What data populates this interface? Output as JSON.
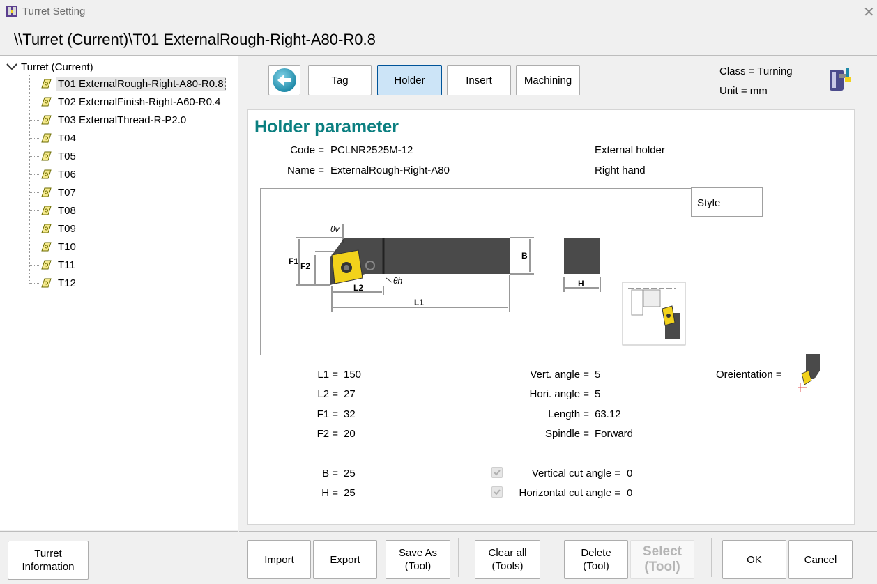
{
  "window": {
    "title": "Turret Setting",
    "path": "\\\\Turret (Current)\\T01 ExternalRough-Right-A80-R0.8"
  },
  "tree": {
    "root": "Turret (Current)",
    "items": [
      {
        "label": "T01 ExternalRough-Right-A80-R0.8",
        "selected": true
      },
      {
        "label": "T02 ExternalFinish-Right-A60-R0.4"
      },
      {
        "label": "T03 ExternalThread-R-P2.0"
      },
      {
        "label": "T04"
      },
      {
        "label": "T05"
      },
      {
        "label": "T06"
      },
      {
        "label": "T07"
      },
      {
        "label": "T08"
      },
      {
        "label": "T09"
      },
      {
        "label": "T10"
      },
      {
        "label": "T11"
      },
      {
        "label": "T12"
      }
    ]
  },
  "tabs": {
    "tag": "Tag",
    "holder": "Holder",
    "insert": "Insert",
    "machining": "Machining",
    "active": "Holder"
  },
  "info": {
    "class": "Class = Turning",
    "unit": "Unit = mm"
  },
  "holder": {
    "heading": "Holder parameter",
    "code_label": "Code =",
    "code_value": "PCLNR2525M-12",
    "name_label": "Name =",
    "name_value": "ExternalRough-Right-A80",
    "type": "External holder",
    "hand": "Right hand",
    "style_label": "Style",
    "diagram_labels": {
      "theta_v": "θv",
      "theta_h": "θh",
      "F1": "F1",
      "F2": "F2",
      "L1": "L1",
      "L2": "L2",
      "B": "B",
      "H": "H"
    },
    "params": {
      "L1_label": "L1 =",
      "L1": "150",
      "L2_label": "L2 =",
      "L2": "27",
      "F1_label": "F1 =",
      "F1": "32",
      "F2_label": "F2 =",
      "F2": "20",
      "B_label": "B =",
      "B": "25",
      "H_label": "H =",
      "H": "25",
      "vert_angle_label": "Vert. angle =",
      "vert_angle": "5",
      "hori_angle_label": "Hori. angle =",
      "hori_angle": "5",
      "length_label": "Length =",
      "length": "63.12",
      "spindle_label": "Spindle =",
      "spindle": "Forward",
      "vertical_cut_label": "Vertical cut angle =",
      "vertical_cut": "0",
      "horizontal_cut_label": "Horizontal cut angle =",
      "horizontal_cut": "0",
      "orientation_label": "Oreientation ="
    }
  },
  "buttons": {
    "turret_info": "Turret\nInformation",
    "import": "Import",
    "export": "Export",
    "save_as": "Save As\n(Tool)",
    "clear_all": "Clear all\n(Tools)",
    "delete": "Delete\n(Tool)",
    "select": "Select\n(Tool)",
    "ok": "OK",
    "cancel": "Cancel"
  },
  "colors": {
    "accent": "#0b7f80",
    "active_tab": "#cce4f7",
    "insert_yellow": "#f2d21b",
    "holder_body": "#4a4a4a"
  }
}
